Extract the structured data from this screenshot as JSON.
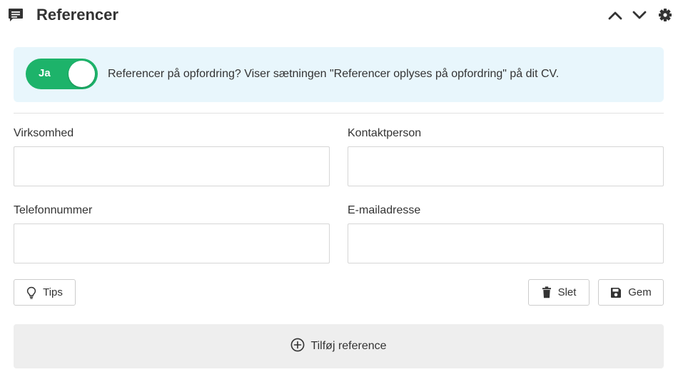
{
  "header": {
    "title": "Referencer",
    "icons": {
      "title": "comment-icon",
      "collapse": "chevron-up-icon",
      "expand": "chevron-down-icon",
      "settings": "gear-icon"
    }
  },
  "info": {
    "toggle_label": "Ja",
    "toggle_on": true,
    "text": "Referencer på opfordring? Viser sætningen \"Referencer oplyses på opfordring\" på dit CV."
  },
  "form": {
    "company": {
      "label": "Virksomhed",
      "value": ""
    },
    "contact": {
      "label": "Kontaktperson",
      "value": ""
    },
    "phone": {
      "label": "Telefonnummer",
      "value": ""
    },
    "email": {
      "label": "E-mailadresse",
      "value": ""
    }
  },
  "actions": {
    "tips_label": "Tips",
    "delete_label": "Slet",
    "save_label": "Gem",
    "icons": {
      "tips": "lightbulb-icon",
      "delete": "trash-icon",
      "save": "floppy-disk-icon"
    }
  },
  "add_reference": {
    "label": "Tilføj reference",
    "icon": "plus-circle-icon"
  },
  "colors": {
    "toggle_on": "#1db36a",
    "info_bg": "#e8f6fc",
    "add_bg": "#eeeeee",
    "text": "#333333"
  }
}
